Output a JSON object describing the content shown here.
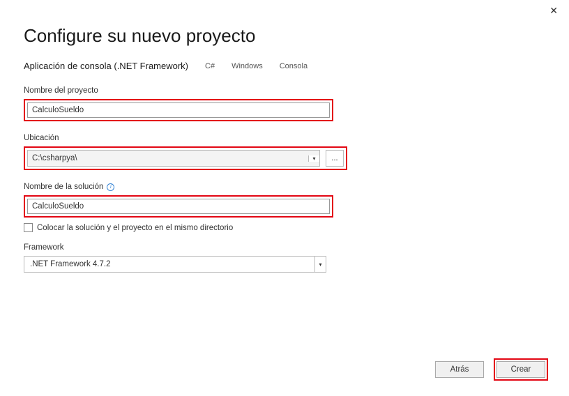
{
  "window": {
    "title": "Configure su nuevo proyecto",
    "subtitle": "Aplicación de consola (.NET Framework)",
    "tags": {
      "lang": "C#",
      "platform": "Windows",
      "type": "Consola"
    }
  },
  "fields": {
    "projectName": {
      "label": "Nombre del proyecto",
      "value": "CalculoSueldo"
    },
    "location": {
      "label": "Ubicación",
      "value": "C:\\csharpya\\",
      "browse": "..."
    },
    "solutionName": {
      "label": "Nombre de la solución",
      "value": "CalculoSueldo"
    },
    "sameDir": {
      "label": "Colocar la solución y el proyecto en el mismo directorio"
    },
    "framework": {
      "label": "Framework",
      "value": ".NET Framework 4.7.2"
    }
  },
  "buttons": {
    "back": "Atrás",
    "create": "Crear"
  }
}
